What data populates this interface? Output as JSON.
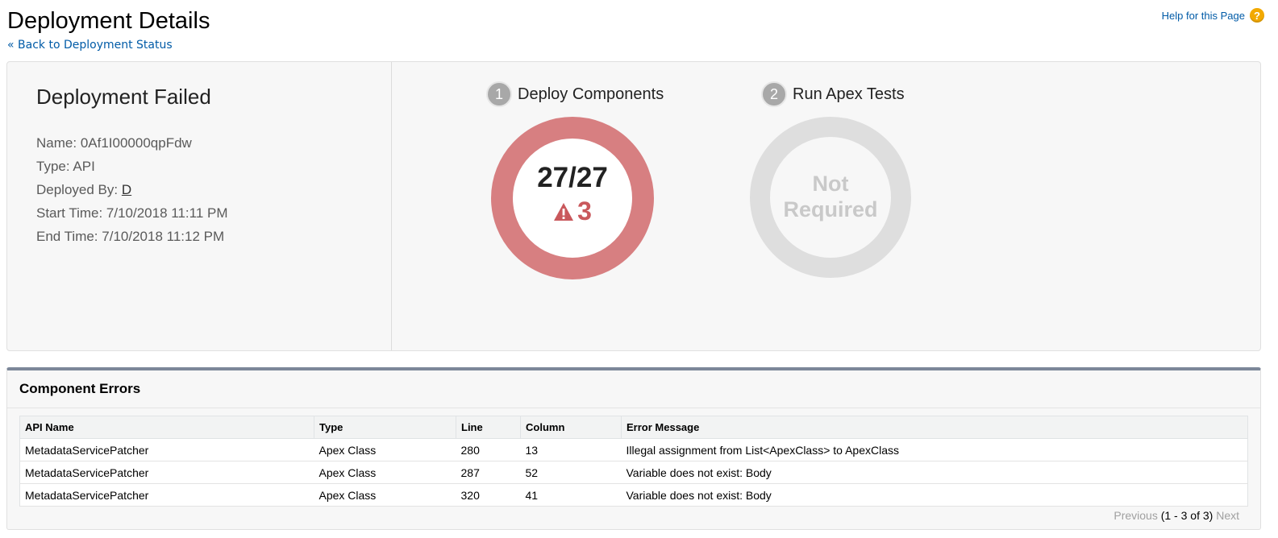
{
  "header": {
    "title": "Deployment Details",
    "back_link": "« Back to Deployment Status",
    "help_link": "Help for this Page",
    "help_icon": "help-icon"
  },
  "status": {
    "title": "Deployment Failed",
    "name_label": "Name:",
    "name_value": "0Af1I00000qpFdw",
    "type_label": "Type:",
    "type_value": "API",
    "deployed_by_label": "Deployed By:",
    "deployed_by_value": "D",
    "start_label": "Start Time:",
    "start_value": "7/10/2018 11:11 PM",
    "end_label": "End Time:",
    "end_value": "7/10/2018 11:12 PM"
  },
  "steps": [
    {
      "number": "1",
      "label": "Deploy Components",
      "count": "27/27",
      "errors": "3",
      "ring_color": "#d77f81",
      "error_color": "#c9585c"
    },
    {
      "number": "2",
      "label": "Run Apex Tests",
      "state_line1": "Not",
      "state_line2": "Required",
      "ring_color": "#dedede"
    }
  ],
  "component_errors": {
    "title": "Component Errors",
    "columns": [
      "API Name",
      "Type",
      "Line",
      "Column",
      "Error Message"
    ],
    "rows": [
      [
        "MetadataServicePatcher",
        "Apex Class",
        "280",
        "13",
        "Illegal assignment from List<ApexClass> to ApexClass"
      ],
      [
        "MetadataServicePatcher",
        "Apex Class",
        "287",
        "52",
        "Variable does not exist: Body"
      ],
      [
        "MetadataServicePatcher",
        "Apex Class",
        "320",
        "41",
        "Variable does not exist: Body"
      ]
    ],
    "pager": {
      "previous": "Previous",
      "range": "(1 - 3 of 3)",
      "next": "Next"
    }
  },
  "colors": {
    "link": "#015ba7",
    "failure_ring": "#d77f81",
    "neutral_ring": "#dedede",
    "panel_accent": "#7c8799"
  }
}
